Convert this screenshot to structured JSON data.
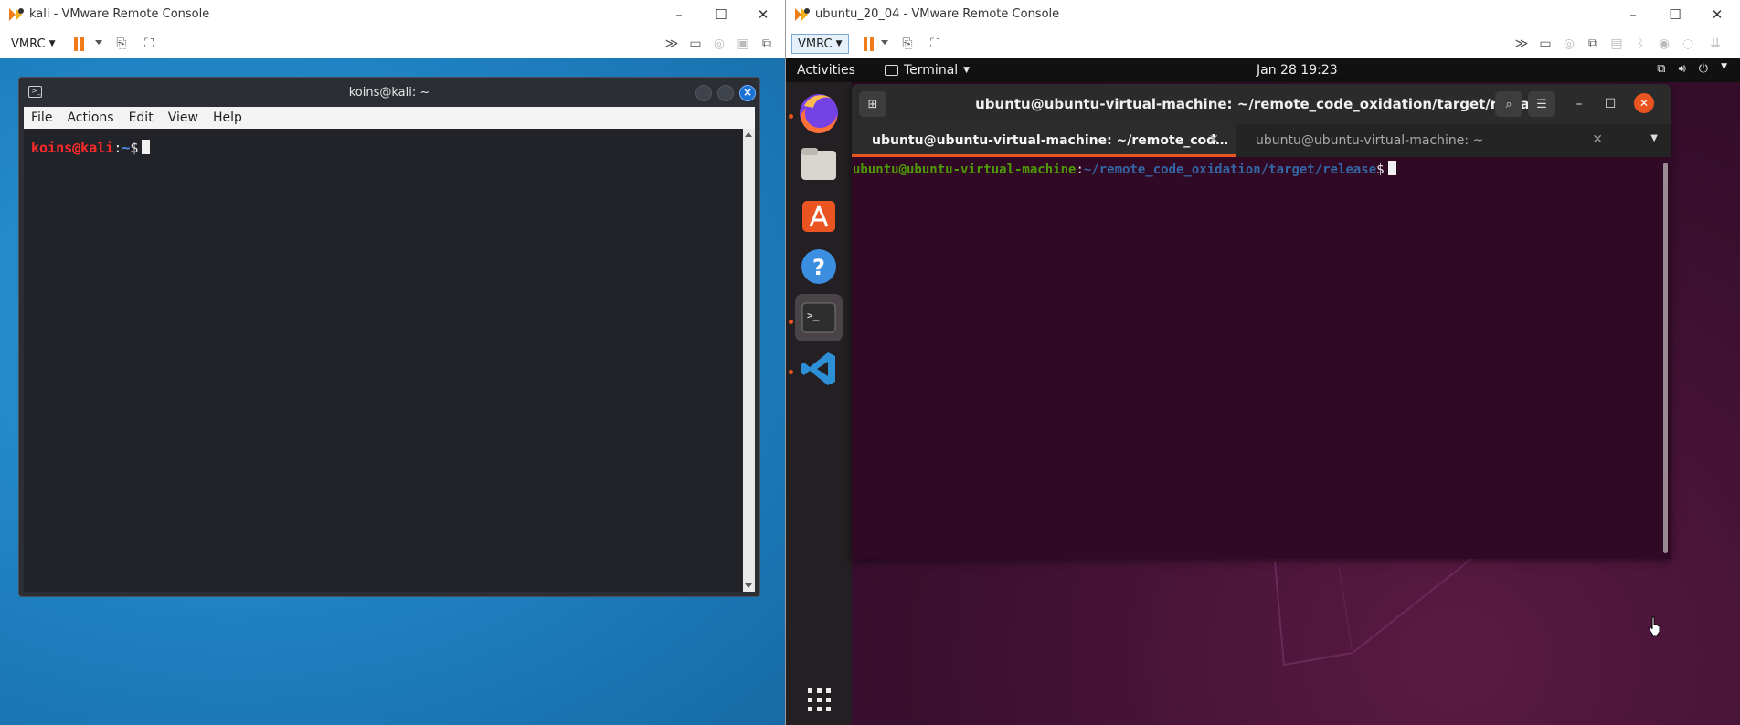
{
  "left_window": {
    "title": "kali - VMware Remote Console",
    "vmrc_label": "VMRC",
    "terminal": {
      "title": "koins@kali: ~",
      "menu": [
        "File",
        "Actions",
        "Edit",
        "View",
        "Help"
      ],
      "prompt_user": "koins@kali",
      "prompt_sep": ":",
      "prompt_path": "~",
      "prompt_symbol": "$"
    }
  },
  "right_window": {
    "title": "ubuntu_20_04 - VMware Remote Console",
    "vmrc_label": "VMRC",
    "topbar": {
      "activities": "Activities",
      "app_name": "Terminal",
      "clock": "Jan 28  19:23"
    },
    "terminal": {
      "title": "ubuntu@ubuntu-virtual-machine: ~/remote_code_oxidation/target/release",
      "tabs": [
        {
          "label": "ubuntu@ubuntu-virtual-machine: ~/remote_cod…",
          "active": true
        },
        {
          "label": "ubuntu@ubuntu-virtual-machine: ~",
          "active": false
        }
      ],
      "prompt_user": "ubuntu@ubuntu-virtual-machine",
      "prompt_sep": ":",
      "prompt_path": "~/remote_code_oxidation/target/release",
      "prompt_symbol": "$"
    },
    "dock": [
      "firefox-icon",
      "files-icon",
      "software-icon",
      "help-icon",
      "terminal-icon",
      "vscode-icon",
      "apps-grid-icon"
    ]
  },
  "colors": {
    "ubuntu_accent": "#e95420",
    "kali_prompt": "#ff2b2b",
    "vmware_pause": "#f07d1a"
  }
}
